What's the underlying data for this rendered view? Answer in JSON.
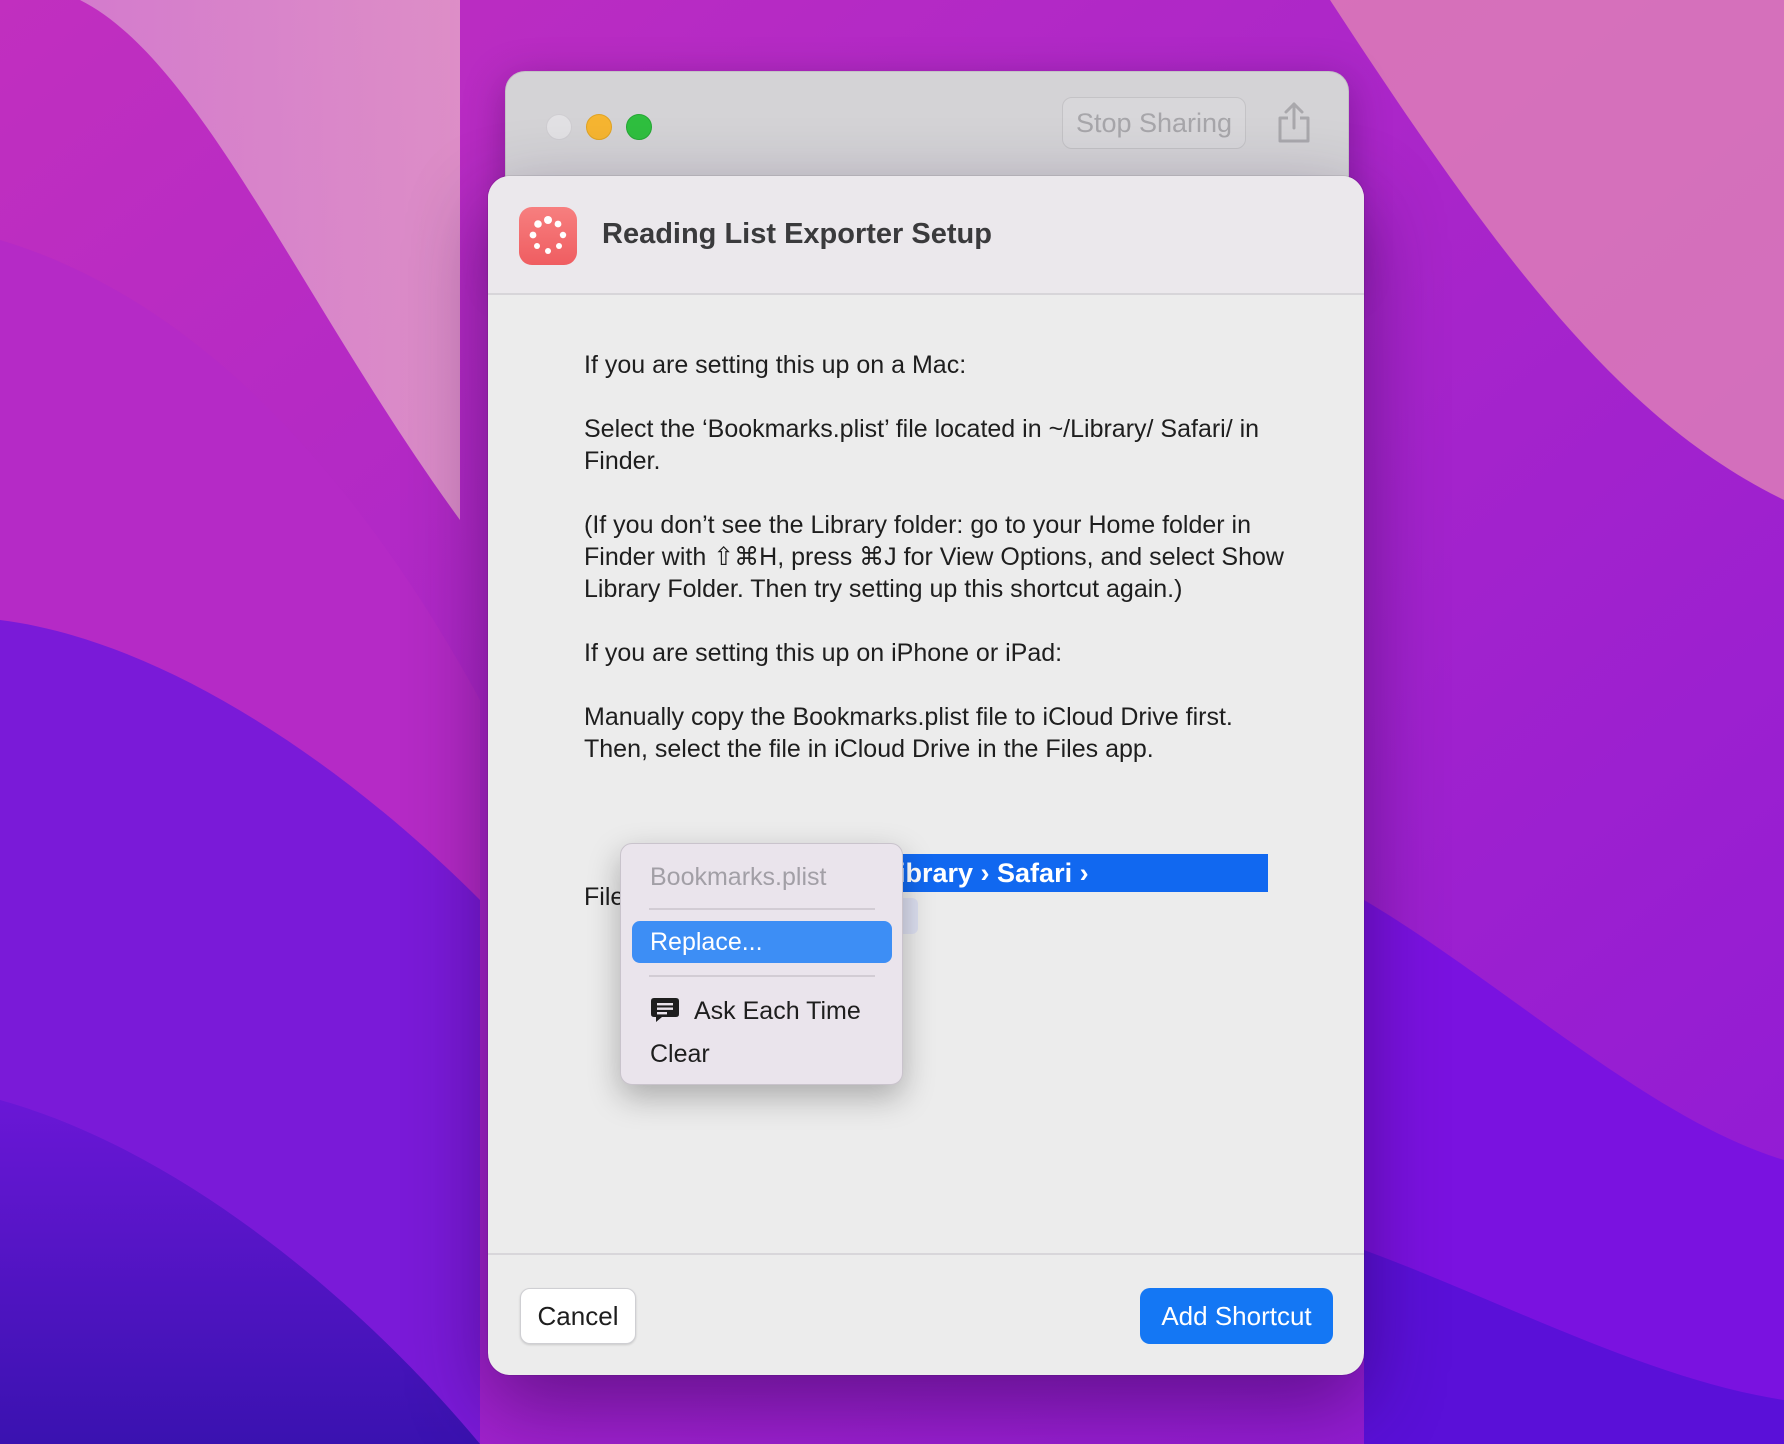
{
  "back_window": {
    "stop_sharing_label": "Stop Sharing"
  },
  "dialog": {
    "title": "Reading List Exporter Setup",
    "paragraphs": [
      "If you are setting this up on a Mac:",
      "Select the ‘Bookmarks.plist’ file located in ~/Library/ Safari/ in Finder.",
      "(If you don’t see the Library folder: go to your Home folder in Finder with ⇧⌘H, press ⌘J for View Options, and select Show Library Folder. Then try setting up this shortcut again.)",
      "If you are setting this up on iPhone or iPad:",
      "Manually copy the Bookmarks.plist file to iCloud Drive first. Then, select the file in iCloud Drive in the Files app."
    ],
    "file_label": "File",
    "path_text": "ibrary › Safari ›"
  },
  "menu": {
    "title": "Bookmarks.plist",
    "replace": "Replace...",
    "ask_each_time": "Ask Each Time",
    "clear": "Clear"
  },
  "footer": {
    "cancel": "Cancel",
    "add_shortcut": "Add Shortcut"
  }
}
